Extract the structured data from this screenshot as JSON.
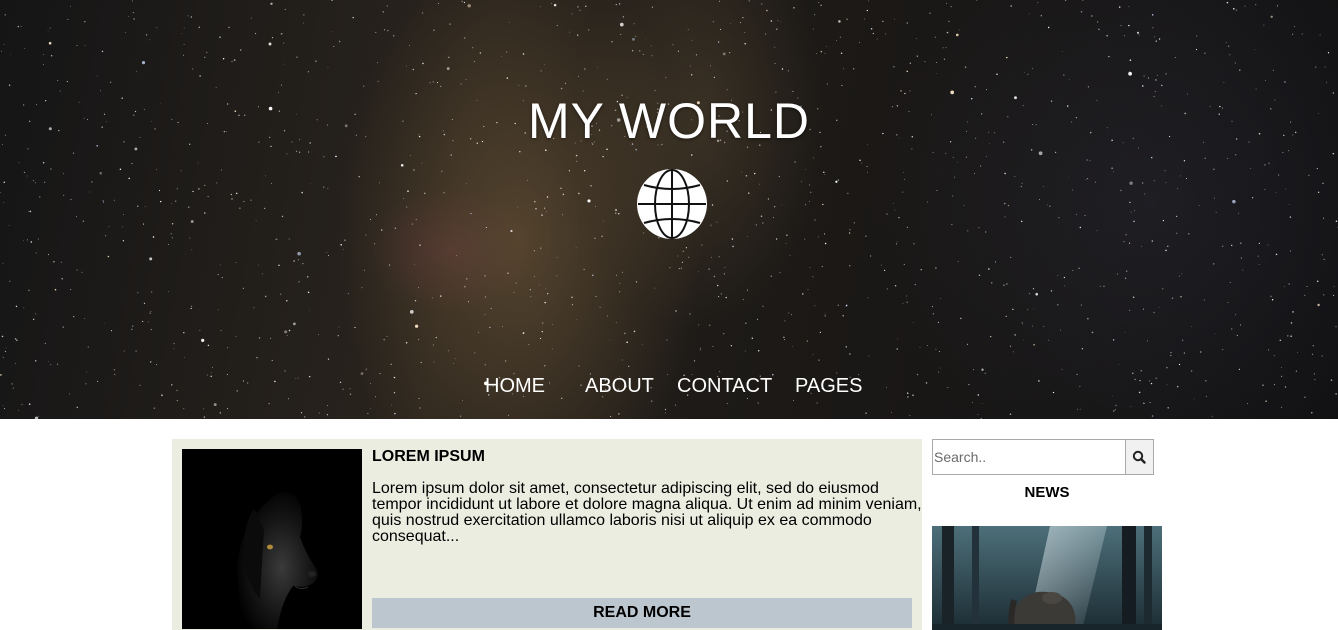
{
  "header": {
    "title": "MY WORLD",
    "logo_icon": "globe-icon"
  },
  "nav": {
    "items": [
      {
        "label": "HOME"
      },
      {
        "label": "ABOUT"
      },
      {
        "label": "CONTACT"
      },
      {
        "label": "PAGES"
      }
    ]
  },
  "post": {
    "title": "LOREM IPSUM",
    "excerpt": "Lorem ipsum dolor sit amet, consectetur adipiscing elit, sed do eiusmod tempor incididunt ut labore et dolore magna aliqua. Ut enim ad minim veniam, quis nostrud exercitation ullamco laboris nisi ut aliquip ex ea commodo consequat...",
    "read_more_label": "READ MORE",
    "image_subject": "black puppy profile"
  },
  "sidebar": {
    "search": {
      "placeholder": "Search..",
      "button_icon": "search-icon"
    },
    "news_heading": "NEWS",
    "news_image_subject": "elephant in a misty forest"
  },
  "colors": {
    "post_background": "#ecede1",
    "read_more_background": "#bcc6cf",
    "hero_text": "#ffffff"
  }
}
